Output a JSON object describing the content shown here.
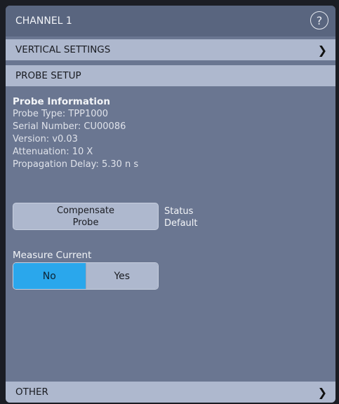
{
  "header": {
    "title": "CHANNEL 1",
    "help_glyph": "?"
  },
  "sections": {
    "vertical_settings": "VERTICAL SETTINGS",
    "probe_setup": "PROBE SETUP",
    "other": "OTHER",
    "chevron": "❯"
  },
  "probe_info": {
    "title": "Probe Information",
    "probe_type": "Probe Type: TPP1000",
    "serial_number": "Serial Number: CU00086",
    "version": "Version: v0.03",
    "attenuation": "Attenuation: 10 X",
    "propagation_delay": "Propagation Delay: 5.30 n s"
  },
  "compensate": {
    "line1": "Compensate",
    "line2": "Probe",
    "status_label": "Status",
    "status_value": "Default"
  },
  "measure_current": {
    "label": "Measure Current",
    "options": [
      "No",
      "Yes"
    ],
    "selected": "No"
  },
  "colors": {
    "panel_bg": "#6a7691",
    "header_bg": "#59657f",
    "section_bg": "#aeb8ce",
    "toggle_selected": "#2aa7ec"
  }
}
